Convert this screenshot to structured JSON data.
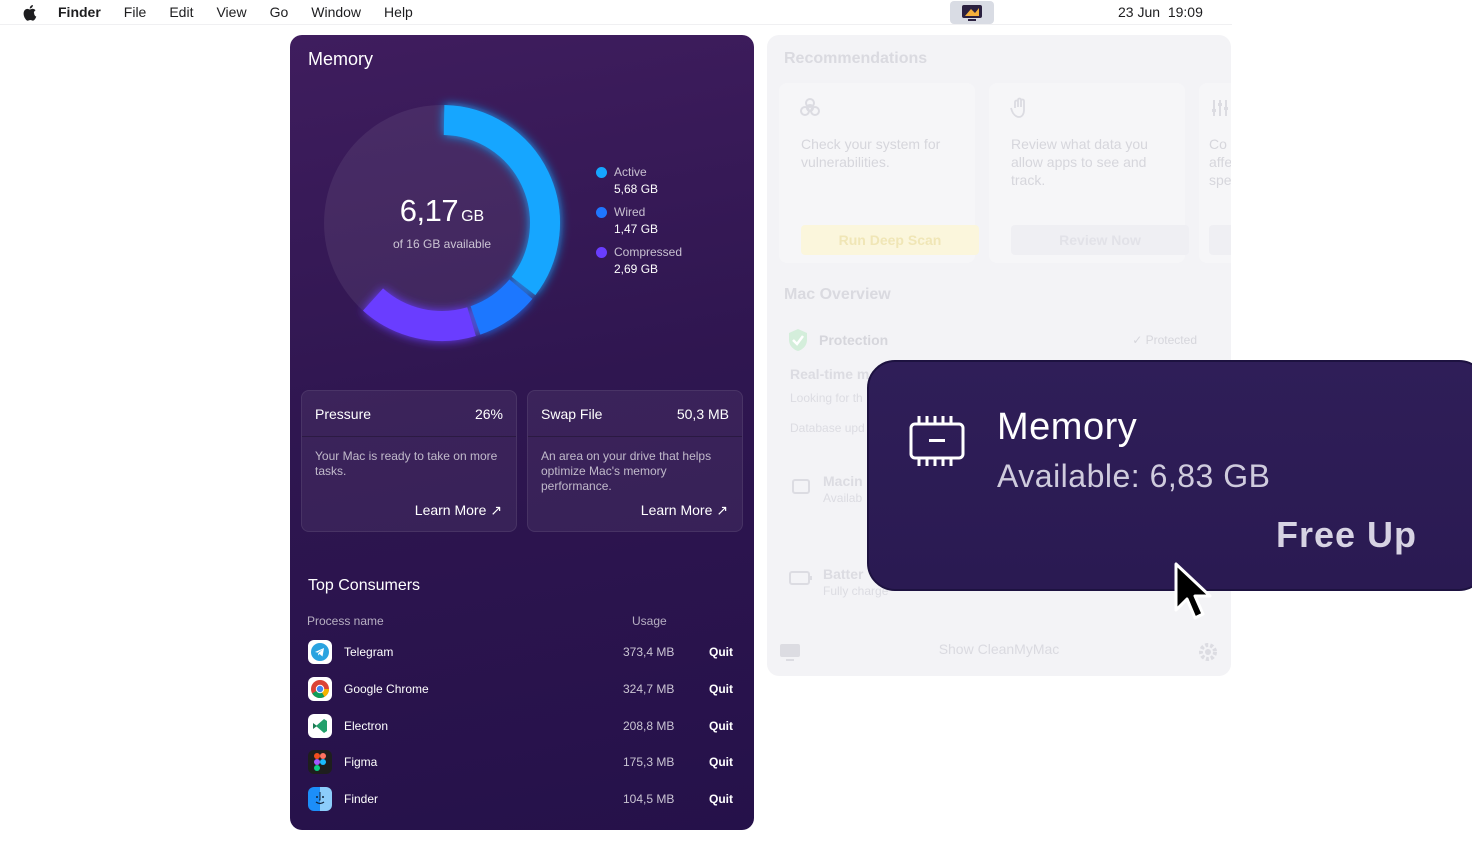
{
  "menubar": {
    "app_name": "Finder",
    "menus": [
      "File",
      "Edit",
      "View",
      "Go",
      "Window",
      "Help"
    ],
    "date": "23 Jun",
    "time": "19:09"
  },
  "memory": {
    "title": "Memory",
    "used_value": "6,17",
    "used_unit": "GB",
    "available_text": "of 16 GB available",
    "legend": [
      {
        "name": "Active",
        "value": "5,68 GB",
        "color": "#16a6ff"
      },
      {
        "name": "Wired",
        "value": "1,47 GB",
        "color": "#1f77ff"
      },
      {
        "name": "Compressed",
        "value": "2,69 GB",
        "color": "#6a3dff"
      }
    ],
    "pressure": {
      "label": "Pressure",
      "value": "26%",
      "description": "Your Mac is ready to take on more tasks.",
      "link": "Learn More ↗"
    },
    "swap": {
      "label": "Swap File",
      "value": "50,3 MB",
      "description": "An area on your drive that helps optimize Mac's memory performance.",
      "link": "Learn More ↗"
    },
    "consumers": {
      "title": "Top Consumers",
      "col_process": "Process name",
      "col_usage": "Usage",
      "quit_label": "Quit",
      "rows": [
        {
          "name": "Telegram",
          "usage": "373,4 MB",
          "icon": "telegram-icon"
        },
        {
          "name": "Google Chrome",
          "usage": "324,7 MB",
          "icon": "chrome-icon"
        },
        {
          "name": "Electron",
          "usage": "208,8 MB",
          "icon": "electron-icon"
        },
        {
          "name": "Figma",
          "usage": "175,3 MB",
          "icon": "figma-icon"
        },
        {
          "name": "Finder",
          "usage": "104,5 MB",
          "icon": "finder-icon"
        }
      ]
    }
  },
  "recommendations": {
    "title": "Recommendations",
    "cards": [
      {
        "icon": "biohazard-icon",
        "description": "Check your system for vulnerabilities.",
        "button": "Run Deep Scan"
      },
      {
        "icon": "hand-icon",
        "description": "Review what data you allow apps to see and track.",
        "button": "Review Now"
      },
      {
        "icon": "sliders-icon",
        "description": "Co affe spe",
        "button": ""
      }
    ],
    "mac_overview": "Mac Overview",
    "protection_label": "Protection",
    "protection_status": "Protected",
    "realtime_label": "Real-time m",
    "looking_for": "Looking for th",
    "database": "Database upd",
    "macintosh_label": "Macin",
    "macintosh_sub": "Availab",
    "battery_label": "Batter",
    "battery_sub": "Fully charge",
    "footer": "Show CleanMyMac"
  },
  "popup": {
    "title": "Memory",
    "available": "Available: 6,83 GB",
    "button": "Free Up"
  }
}
